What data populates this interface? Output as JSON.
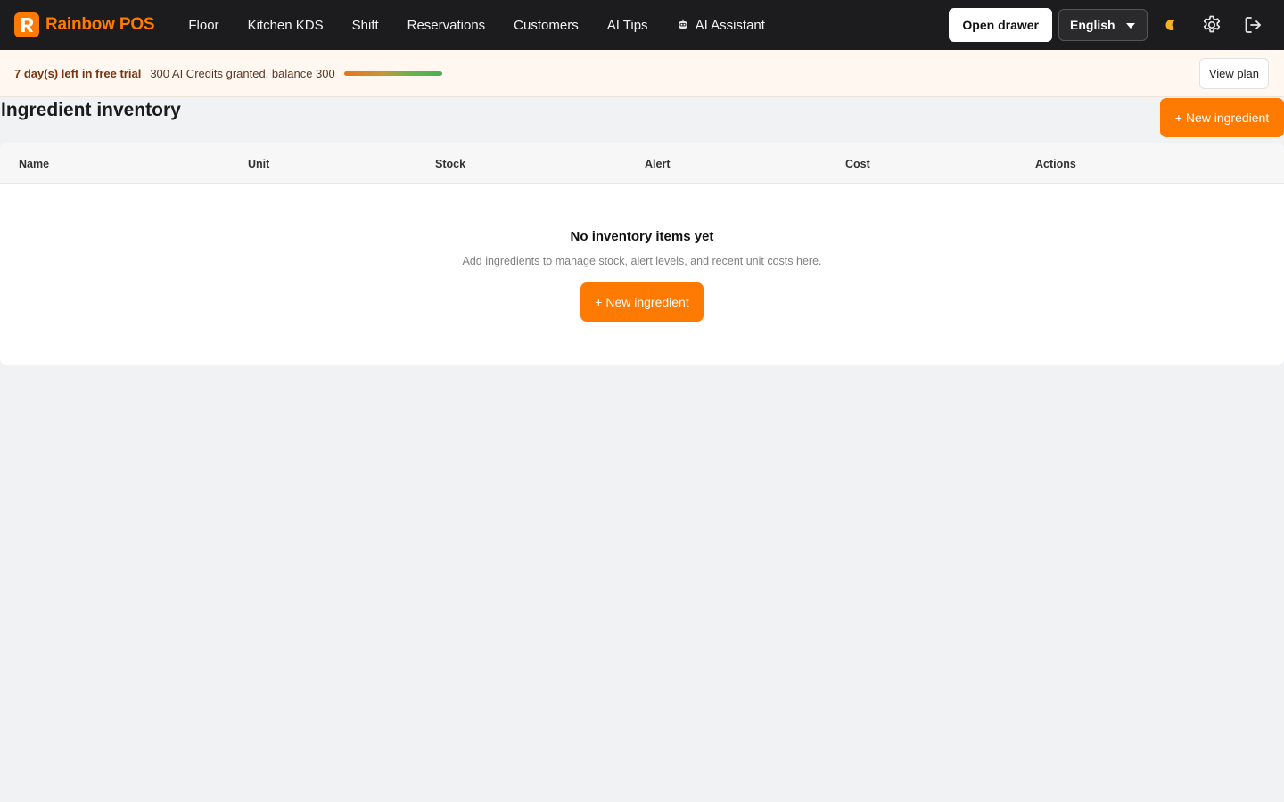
{
  "app": {
    "name": "Rainbow POS"
  },
  "nav": {
    "items": [
      {
        "label": "Floor"
      },
      {
        "label": "Kitchen KDS"
      },
      {
        "label": "Shift"
      },
      {
        "label": "Reservations"
      },
      {
        "label": "Customers"
      },
      {
        "label": "AI Tips"
      },
      {
        "label": "AI Assistant",
        "icon": "robot-icon"
      }
    ]
  },
  "header": {
    "open_drawer_label": "Open drawer",
    "language": "English",
    "theme_icon": "moon-icon",
    "settings_icon": "gear-icon",
    "logout_icon": "logout-icon"
  },
  "trial": {
    "days_left": "7 day(s) left in free trial",
    "credits": "300 AI Credits granted, balance 300",
    "credit_fraction": 1.0,
    "view_plan_label": "View plan"
  },
  "page": {
    "title": "Ingredient inventory",
    "new_button_label": "+ New ingredient"
  },
  "table": {
    "columns": [
      "Name",
      "Unit",
      "Stock",
      "Alert",
      "Cost",
      "Actions"
    ],
    "empty": {
      "title": "No inventory items yet",
      "subtitle": "Add ingredients to manage stock, alert levels, and recent unit costs here.",
      "button_label": "+ New ingredient"
    }
  },
  "colors": {
    "accent": "#ff7a00",
    "topbar": "#1c1c1e",
    "background": "#f1f2f4"
  }
}
